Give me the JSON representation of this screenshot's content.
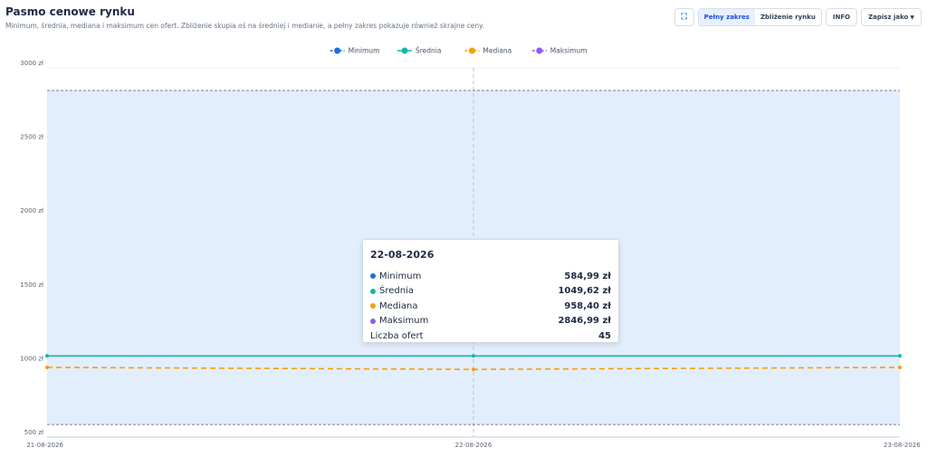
{
  "header": {
    "title": "Pasmo cenowe rynku",
    "subtitle": "Minimum, średnia, mediana i maksimum cen ofert. Zbliżenie skupia oś na średniej i medianie, a pełny zakres pokazuje również skrajne ceny."
  },
  "toolbar": {
    "full_range_label": "Pełny zakres",
    "zoom_label": "Zbliżenie rynku",
    "info_label": "INFO",
    "save_label": "Zapisz jako",
    "active_view": "Pełny zakres"
  },
  "tooltip": {
    "date": "22-08-2026",
    "rows": [
      {
        "label": "Minimum",
        "value": "584,99 zł",
        "color": "#1a6fe0"
      },
      {
        "label": "Średnia",
        "value": "1049,62 zł",
        "color": "#14b8a6"
      },
      {
        "label": "Mediana",
        "value": "958,40 zł",
        "color": "#f59e0b"
      },
      {
        "label": "Maksimum",
        "value": "2846,99 zł",
        "color": "#8b5cf6"
      }
    ],
    "count_label": "Liczba ofert",
    "count_value": "45"
  },
  "chart_data": {
    "type": "line",
    "title": "Pasmo cenowe rynku",
    "x": [
      "21-08-2026",
      "22-08-2026",
      "23-08-2026"
    ],
    "series": [
      {
        "name": "Minimum",
        "values": [
          584.99,
          584.99,
          584.99
        ],
        "color": "#1a6fe0",
        "style": "dashed"
      },
      {
        "name": "Średnia",
        "values": [
          1049.62,
          1049.62,
          1049.62
        ],
        "color": "#14b8a6",
        "style": "solid"
      },
      {
        "name": "Mediana",
        "values": [
          972.0,
          958.4,
          972.0
        ],
        "color": "#f59e0b",
        "style": "dashed"
      },
      {
        "name": "Maksimum",
        "values": [
          2846.99,
          2846.99,
          2846.99
        ],
        "color": "#8b5cf6",
        "style": "dashed"
      }
    ],
    "band": {
      "from_series": "Minimum",
      "to_series": "Maksimum",
      "color": "#e3eefc"
    },
    "ylim": [
      500,
      3000
    ],
    "yticks": [
      500,
      1000,
      1500,
      2000,
      2500,
      3000
    ],
    "ytick_labels": [
      "500 zł",
      "1000 zł",
      "1500 zł",
      "2000 zł",
      "2500 zł",
      "3000 zł"
    ],
    "legend_position": "top-center",
    "grid": true,
    "hover_index": 1
  }
}
